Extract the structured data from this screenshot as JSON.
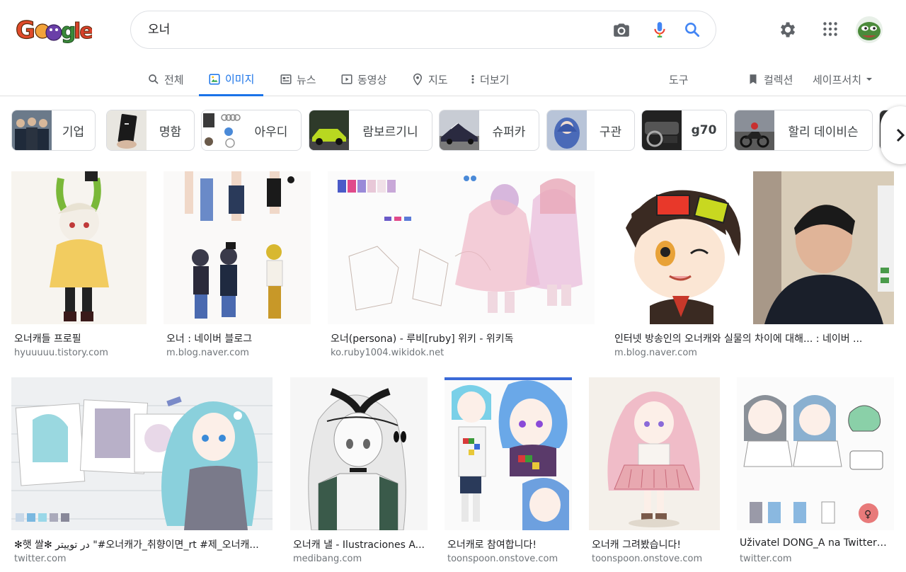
{
  "search": {
    "query": "오너"
  },
  "tabs": [
    {
      "label": "전체"
    },
    {
      "label": "이미지"
    },
    {
      "label": "뉴스"
    },
    {
      "label": "동영상"
    },
    {
      "label": "지도"
    },
    {
      "label": "더보기"
    }
  ],
  "tools_label": "도구",
  "collections_label": "컬렉션",
  "safesearch_label": "세이프서치",
  "chips": [
    {
      "label": "기업"
    },
    {
      "label": "명함"
    },
    {
      "label": "아우디"
    },
    {
      "label": "람보르기니"
    },
    {
      "label": "슈퍼카"
    },
    {
      "label": "구관"
    },
    {
      "label": "g70"
    },
    {
      "label": "할리 데이비슨"
    }
  ],
  "results": [
    {
      "title": "오너캐들 프로필",
      "source": "hyuuuuu.tistory.com"
    },
    {
      "title": "오너 : 네이버 블로그",
      "source": "m.blog.naver.com"
    },
    {
      "title": "오너(persona) - 루비[ruby] 위키 - 위키독",
      "source": "ko.ruby1004.wikidok.net"
    },
    {
      "title": "인터넷 방송인의 오너캐와 실물의 차이에 대해... : 네이버 ...",
      "source": "m.blog.naver.com"
    },
    {
      "title": "✻햇 쌀✻ در توییتر \"#오너캐가_취향이면_rt #제_오너캐...",
      "source": "twitter.com"
    },
    {
      "title": "오너캐 낼 - Ilustraciones A...",
      "source": "medibang.com"
    },
    {
      "title": "오너캐로 참여합니다!",
      "source": "toonspoon.onstove.com"
    },
    {
      "title": "오너캐 그려봤습니다!",
      "source": "toonspoon.onstove.com"
    },
    {
      "title": "Uživatel DONG_A na Twitteru: ...",
      "source": "twitter.com"
    }
  ],
  "colors": {
    "accent": "#1a73e8",
    "muted": "#5f6368"
  }
}
